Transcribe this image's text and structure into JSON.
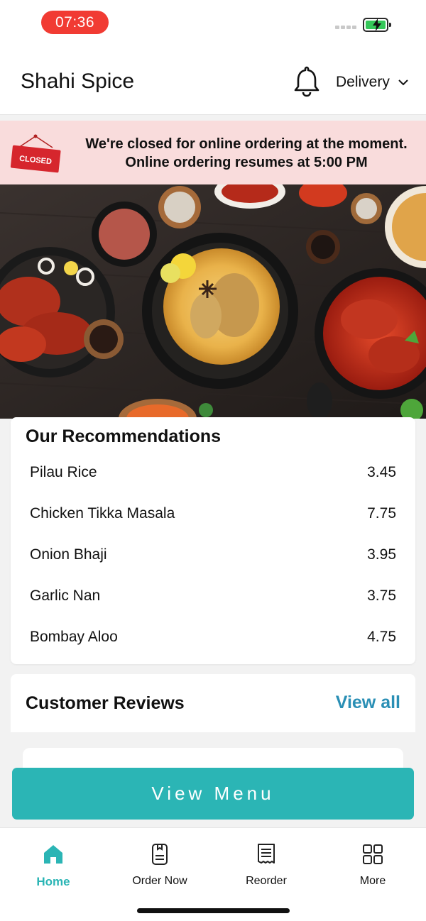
{
  "status_bar": {
    "time": "07:36",
    "battery_icon": "battery-charging-icon",
    "signal_icon": "signal-icon"
  },
  "header": {
    "title": "Shahi Spice",
    "bell_icon": "bell-icon",
    "delivery_label": "Delivery",
    "chevron_icon": "chevron-down-icon"
  },
  "banner": {
    "sign_text": "CLOSED",
    "line1": "We're closed for online ordering at the moment.",
    "line2": "Online ordering resumes at 5:00 PM",
    "background": "#f9dcdc"
  },
  "recommendations": {
    "title": "Our Recommendations",
    "items": [
      {
        "name": "Pilau Rice",
        "price": "3.45"
      },
      {
        "name": "Chicken Tikka Masala",
        "price": "7.75"
      },
      {
        "name": "Onion Bhaji",
        "price": "3.95"
      },
      {
        "name": "Garlic Nan",
        "price": "3.75"
      },
      {
        "name": "Bombay Aloo",
        "price": "4.75"
      }
    ]
  },
  "reviews": {
    "title": "Customer Reviews",
    "view_all": "View all"
  },
  "view_menu": {
    "label": "View Menu"
  },
  "bottom_nav": {
    "items": [
      {
        "label": "Home",
        "icon": "home-icon",
        "active": true
      },
      {
        "label": "Order Now",
        "icon": "order-icon",
        "active": false
      },
      {
        "label": "Reorder",
        "icon": "receipt-icon",
        "active": false
      },
      {
        "label": "More",
        "icon": "grid-icon",
        "active": false
      }
    ]
  },
  "colors": {
    "accent": "#2bb5b5",
    "link": "#2a8fb5",
    "time_pill": "#f13b33",
    "sign_red": "#d6262d"
  }
}
